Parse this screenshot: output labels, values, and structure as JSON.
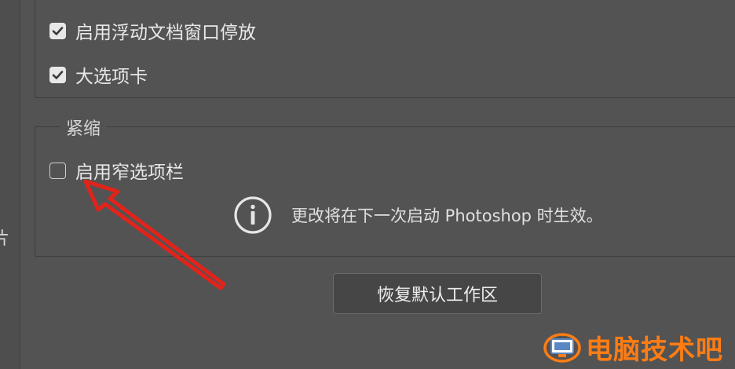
{
  "side": {
    "partial_char": "片"
  },
  "docking": {
    "items": [
      {
        "label": "启用浮动文档窗口停放",
        "checked": true
      },
      {
        "label": "大选项卡",
        "checked": true
      }
    ]
  },
  "compact": {
    "title": "紧缩",
    "narrow_tab_label": "启用窄选项栏",
    "narrow_tab_checked": false,
    "info_text": "更改将在下一次启动 Photoshop 时生效。"
  },
  "restore_button_label": "恢复默认工作区",
  "watermark": {
    "text": "电脑技术吧"
  },
  "colors": {
    "background": "#535353",
    "arrow": "#e2231a",
    "watermark": "#ff7d14"
  }
}
